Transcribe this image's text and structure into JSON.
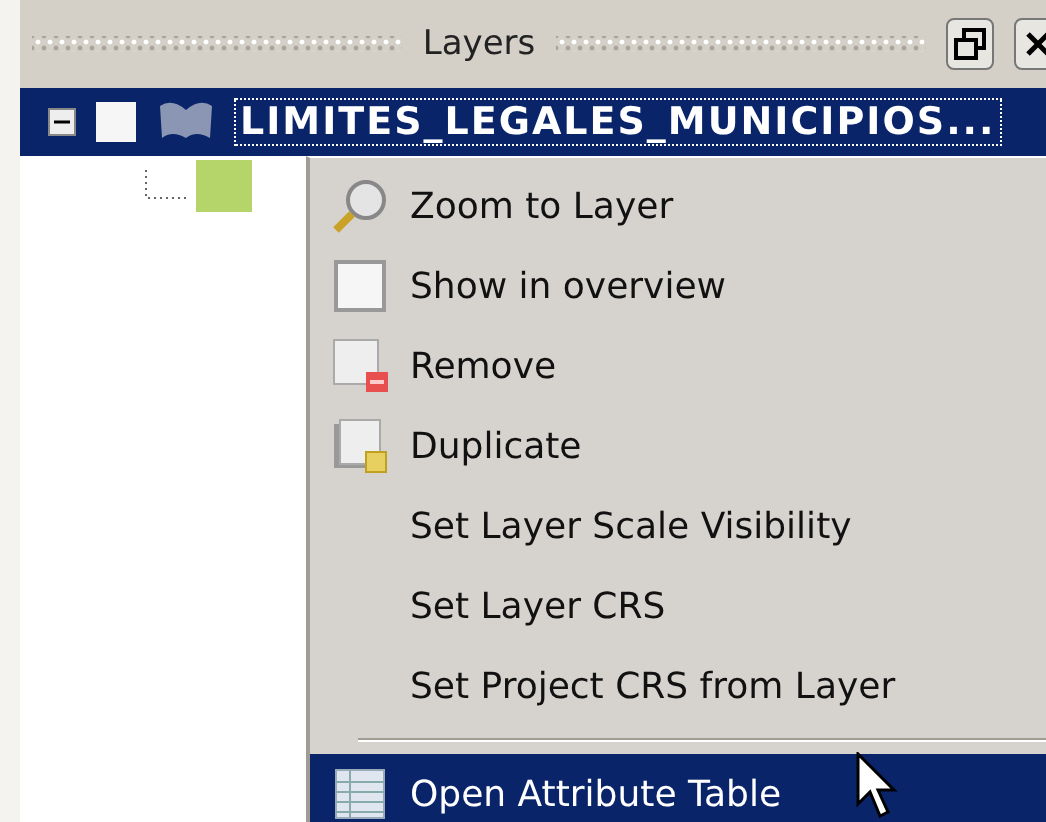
{
  "panel": {
    "title": "Layers"
  },
  "layers": [
    {
      "name": "LIMITES_LEGALES_MUNICIPIOS...",
      "selected": true,
      "visible": false,
      "expanded": true
    }
  ],
  "context_menu": [
    {
      "kind": "zoom",
      "label": "Zoom to Layer",
      "selected": false
    },
    {
      "kind": "check",
      "label": "Show in overview",
      "selected": false,
      "checked": false
    },
    {
      "kind": "remove",
      "label": "Remove",
      "selected": false
    },
    {
      "kind": "duplicate",
      "label": "Duplicate",
      "selected": false
    },
    {
      "kind": "plain",
      "label": "Set Layer Scale Visibility",
      "selected": false
    },
    {
      "kind": "plain",
      "label": "Set Layer CRS",
      "selected": false
    },
    {
      "kind": "plain",
      "label": "Set Project CRS from Layer",
      "selected": false
    },
    {
      "kind": "separator"
    },
    {
      "kind": "table",
      "label": "Open Attribute Table",
      "selected": true
    }
  ]
}
